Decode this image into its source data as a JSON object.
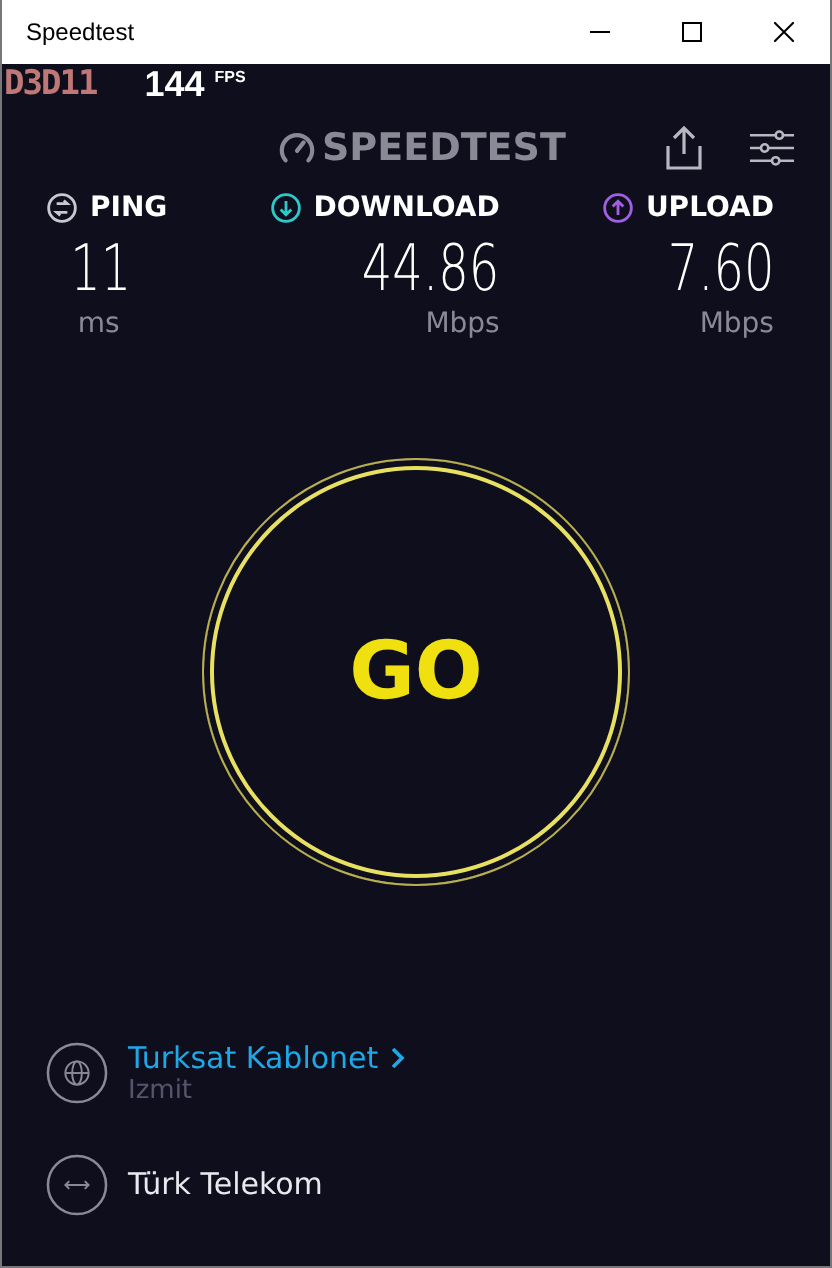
{
  "window": {
    "title": "Speedtest"
  },
  "overlay": {
    "api": "D3D11",
    "fps": "144",
    "fps_unit": "FPS"
  },
  "header": {
    "logo_text": "SPEEDTEST"
  },
  "metrics": [
    {
      "kind": "ping",
      "label": "PING",
      "value": "11",
      "unit": "ms"
    },
    {
      "kind": "download",
      "label": "DOWNLOAD",
      "value": "44.86",
      "unit": "Mbps"
    },
    {
      "kind": "upload",
      "label": "UPLOAD",
      "value": "7.60",
      "unit": "Mbps"
    }
  ],
  "go_button": {
    "label": "GO"
  },
  "connections": [
    {
      "kind": "server",
      "name": "Turksat Kablonet",
      "location": "Izmit"
    },
    {
      "kind": "provider",
      "name": "Türk Telekom"
    }
  ]
}
